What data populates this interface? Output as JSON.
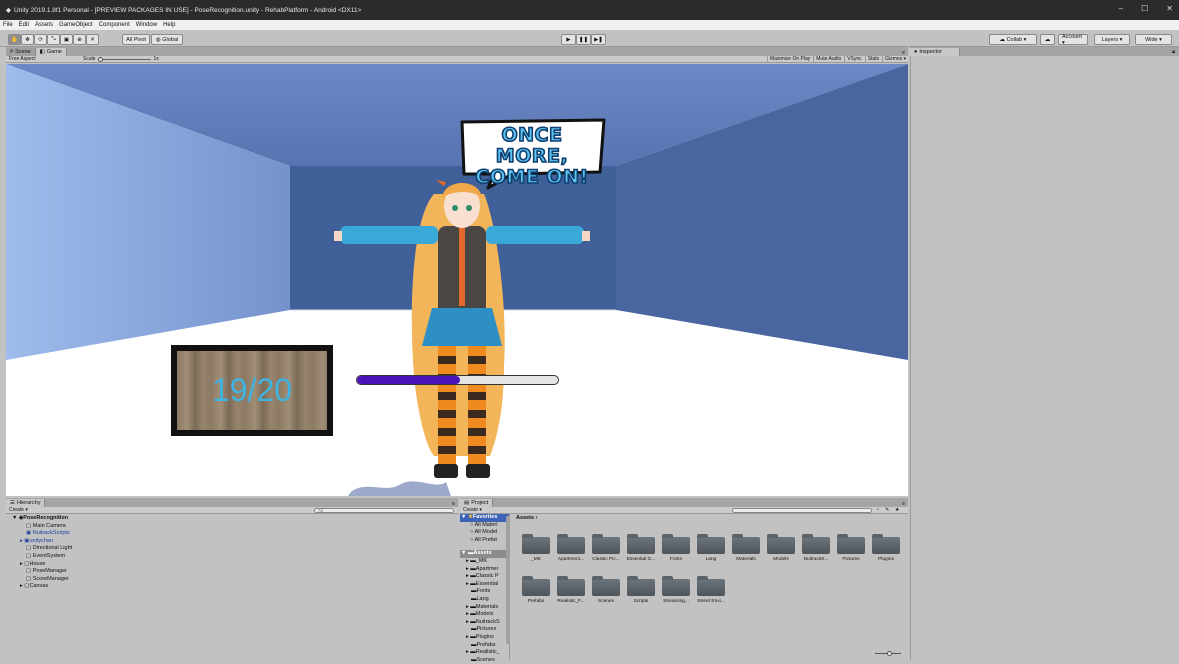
{
  "window": {
    "title": "Unity 2019.1.8f1 Personal - [PREVIEW PACKAGES IN USE] - PoseRecognition.unity - RehabPlatform - Android <DX11>",
    "controls": [
      "–",
      "☐",
      "✕"
    ]
  },
  "menu": [
    "File",
    "Edit",
    "Assets",
    "GameObject",
    "Component",
    "Window",
    "Help"
  ],
  "toolbar": {
    "pivot_label": "All Pivot",
    "global_label": "Global",
    "collab_label": "Collab ▾",
    "account_label": "Account ▾",
    "layers_label": "Layers ▾",
    "layout_label": "Wide ▾"
  },
  "scene_tabs": {
    "scene": "Scene",
    "game": "Game"
  },
  "game_bar": {
    "aspect": "Free Aspect",
    "scale_label": "Scale",
    "scale_value": "1x",
    "toggles": [
      "Maximize On Play",
      "Mute Audio",
      "VSync",
      "Stats",
      "Gizmos ▾"
    ]
  },
  "game": {
    "speech_line1": "ONCE MORE,",
    "speech_line2": "COME ON!",
    "counter": "19/20",
    "progress_fraction": 0.51,
    "progress_color": "#4a12b8"
  },
  "inspector": {
    "title": "Inspector"
  },
  "hierarchy": {
    "title": "Hierarchy",
    "create_label": "Create ▾",
    "search_placeholder": "All",
    "scene_name": "PoseRecognition",
    "items": [
      "Main Camera",
      "NuitrackScripts",
      "unitychan",
      "Directional Light",
      "EventSystem",
      "House",
      "PoseManager",
      "ScoreManager",
      "Canvas"
    ]
  },
  "project": {
    "title": "Project",
    "create_label": "Create ▾",
    "favorites_label": "Favorites",
    "favorites": [
      "All Materi",
      "All Model",
      "All Prefat"
    ],
    "assets_label": "Assets",
    "tree": [
      "_MK",
      "Apartmer",
      "Classic P",
      "Essential",
      "Fonts",
      "Lang",
      "Materials",
      "Models",
      "NuitrackS",
      "Pictures",
      "Plugins",
      "Prefabs",
      "Realistic_",
      "Scenes"
    ],
    "breadcrumb": "Assets ›",
    "folders": [
      "_MK",
      "Apartment...",
      "Classic Pic...",
      "Essential G...",
      "Fonts",
      "Lang",
      "Materials",
      "Models",
      "NuitrackS...",
      "Pictures",
      "Plugins",
      "Prefabs",
      "Realistic_F...",
      "Scenes",
      "Scripts",
      "Streaming...",
      "Street Envi..."
    ]
  },
  "colors": {
    "wall_light": "#7f9fd4",
    "wall_dark": "#47649a",
    "floor": "#ffffff",
    "editor_bg": "#c2c2c2"
  }
}
